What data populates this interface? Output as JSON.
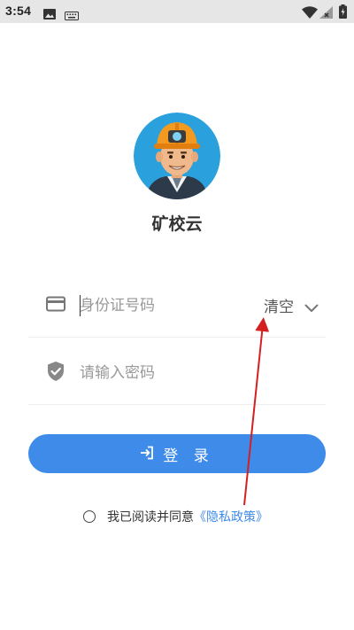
{
  "status_bar": {
    "time": "3:54",
    "icons": [
      "gallery-icon",
      "keyboard-icon",
      "wifi-icon",
      "signal-icon",
      "battery-icon"
    ]
  },
  "app": {
    "name": "矿校云",
    "avatar": "miner-avatar"
  },
  "form": {
    "id_field": {
      "placeholder": "身份证号码",
      "value": "",
      "icon": "card-icon",
      "clear_label": "清空",
      "dropdown_icon": "chevron-down-icon"
    },
    "password_field": {
      "placeholder": "请输入密码",
      "value": "",
      "icon": "shield-check-icon"
    },
    "login_button": {
      "label": "登 录",
      "icon": "login-icon"
    }
  },
  "agreement": {
    "text": "我已阅读并同意",
    "link_label": "《隐私政策》",
    "checked": false
  },
  "colors": {
    "primary": "#3f8bea",
    "annotation_arrow": "#d42020",
    "status_bar_bg": "#e6e6e6"
  }
}
